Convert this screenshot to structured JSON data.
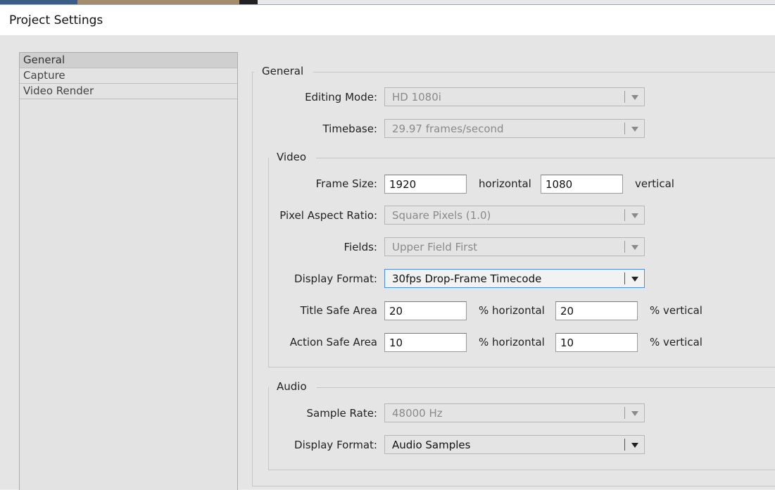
{
  "window": {
    "title": "Project Settings"
  },
  "nav": {
    "items": [
      {
        "label": "General",
        "selected": true
      },
      {
        "label": "Capture",
        "selected": false
      },
      {
        "label": "Video Render",
        "selected": false
      }
    ]
  },
  "general": {
    "legend": "General",
    "editing_mode": {
      "label": "Editing Mode:",
      "value": "HD 1080i"
    },
    "timebase": {
      "label": "Timebase:",
      "value": "29.97 frames/second"
    }
  },
  "video": {
    "legend": "Video",
    "frame_size": {
      "label": "Frame Size:",
      "width": "1920",
      "width_unit": "horizontal",
      "height": "1080",
      "height_unit": "vertical"
    },
    "pixel_aspect_ratio": {
      "label": "Pixel Aspect Ratio:",
      "value": "Square Pixels (1.0)"
    },
    "fields": {
      "label": "Fields:",
      "value": "Upper Field First"
    },
    "display_format": {
      "label": "Display Format:",
      "value": "30fps Drop-Frame Timecode"
    },
    "title_safe_area": {
      "label": "Title Safe Area",
      "horizontal": "20",
      "horizontal_unit": "% horizontal",
      "vertical": "20",
      "vertical_unit": "% vertical"
    },
    "action_safe_area": {
      "label": "Action Safe Area",
      "horizontal": "10",
      "horizontal_unit": "% horizontal",
      "vertical": "10",
      "vertical_unit": "% vertical"
    }
  },
  "audio": {
    "legend": "Audio",
    "sample_rate": {
      "label": "Sample Rate:",
      "value": "48000 Hz"
    },
    "display_format": {
      "label": "Display Format:",
      "value": "Audio Samples"
    }
  },
  "colors": {
    "focus_border": "#4a90d9",
    "disabled_text": "#8a8a8a"
  }
}
